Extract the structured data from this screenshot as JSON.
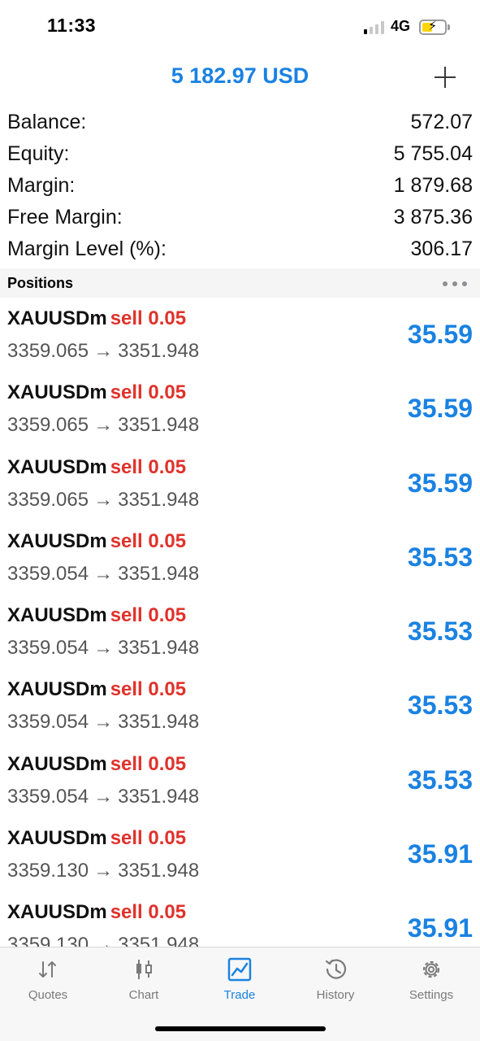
{
  "status_bar": {
    "time": "11:33",
    "network": "4G",
    "signal_bars_active": 1,
    "signal_bars_total": 4
  },
  "header": {
    "title": "5 182.97 USD",
    "add_icon": "plus-icon"
  },
  "summary": [
    {
      "label": "Balance:",
      "value": "572.07"
    },
    {
      "label": "Equity:",
      "value": "5 755.04"
    },
    {
      "label": "Margin:",
      "value": "1 879.68"
    },
    {
      "label": "Free Margin:",
      "value": "3 875.36"
    },
    {
      "label": "Margin Level (%):",
      "value": "306.17"
    }
  ],
  "positions_header": {
    "title": "Positions",
    "more_icon": "more-dots-icon"
  },
  "positions": [
    {
      "symbol": "XAUUSDm",
      "side": "sell 0.05",
      "open": "3359.065",
      "arrow": "→",
      "current": "3351.948",
      "profit": "35.59"
    },
    {
      "symbol": "XAUUSDm",
      "side": "sell 0.05",
      "open": "3359.065",
      "arrow": "→",
      "current": "3351.948",
      "profit": "35.59"
    },
    {
      "symbol": "XAUUSDm",
      "side": "sell 0.05",
      "open": "3359.065",
      "arrow": "→",
      "current": "3351.948",
      "profit": "35.59"
    },
    {
      "symbol": "XAUUSDm",
      "side": "sell 0.05",
      "open": "3359.054",
      "arrow": "→",
      "current": "3351.948",
      "profit": "35.53"
    },
    {
      "symbol": "XAUUSDm",
      "side": "sell 0.05",
      "open": "3359.054",
      "arrow": "→",
      "current": "3351.948",
      "profit": "35.53"
    },
    {
      "symbol": "XAUUSDm",
      "side": "sell 0.05",
      "open": "3359.054",
      "arrow": "→",
      "current": "3351.948",
      "profit": "35.53"
    },
    {
      "symbol": "XAUUSDm",
      "side": "sell 0.05",
      "open": "3359.054",
      "arrow": "→",
      "current": "3351.948",
      "profit": "35.53"
    },
    {
      "symbol": "XAUUSDm",
      "side": "sell 0.05",
      "open": "3359.130",
      "arrow": "→",
      "current": "3351.948",
      "profit": "35.91"
    },
    {
      "symbol": "XAUUSDm",
      "side": "sell 0.05",
      "open": "3359.130",
      "arrow": "→",
      "current": "3351.948",
      "profit": "35.91"
    }
  ],
  "tabs": [
    {
      "label": "Quotes",
      "icon": "quotes-arrows-icon",
      "active": false
    },
    {
      "label": "Chart",
      "icon": "candlestick-chart-icon",
      "active": false
    },
    {
      "label": "Trade",
      "icon": "trade-line-chart-icon",
      "active": true
    },
    {
      "label": "History",
      "icon": "history-clock-icon",
      "active": false
    },
    {
      "label": "Settings",
      "icon": "gear-icon",
      "active": false
    }
  ],
  "colors": {
    "accent": "#1a82e2",
    "sell": "#e0322b",
    "muted": "#7a7a7a"
  }
}
